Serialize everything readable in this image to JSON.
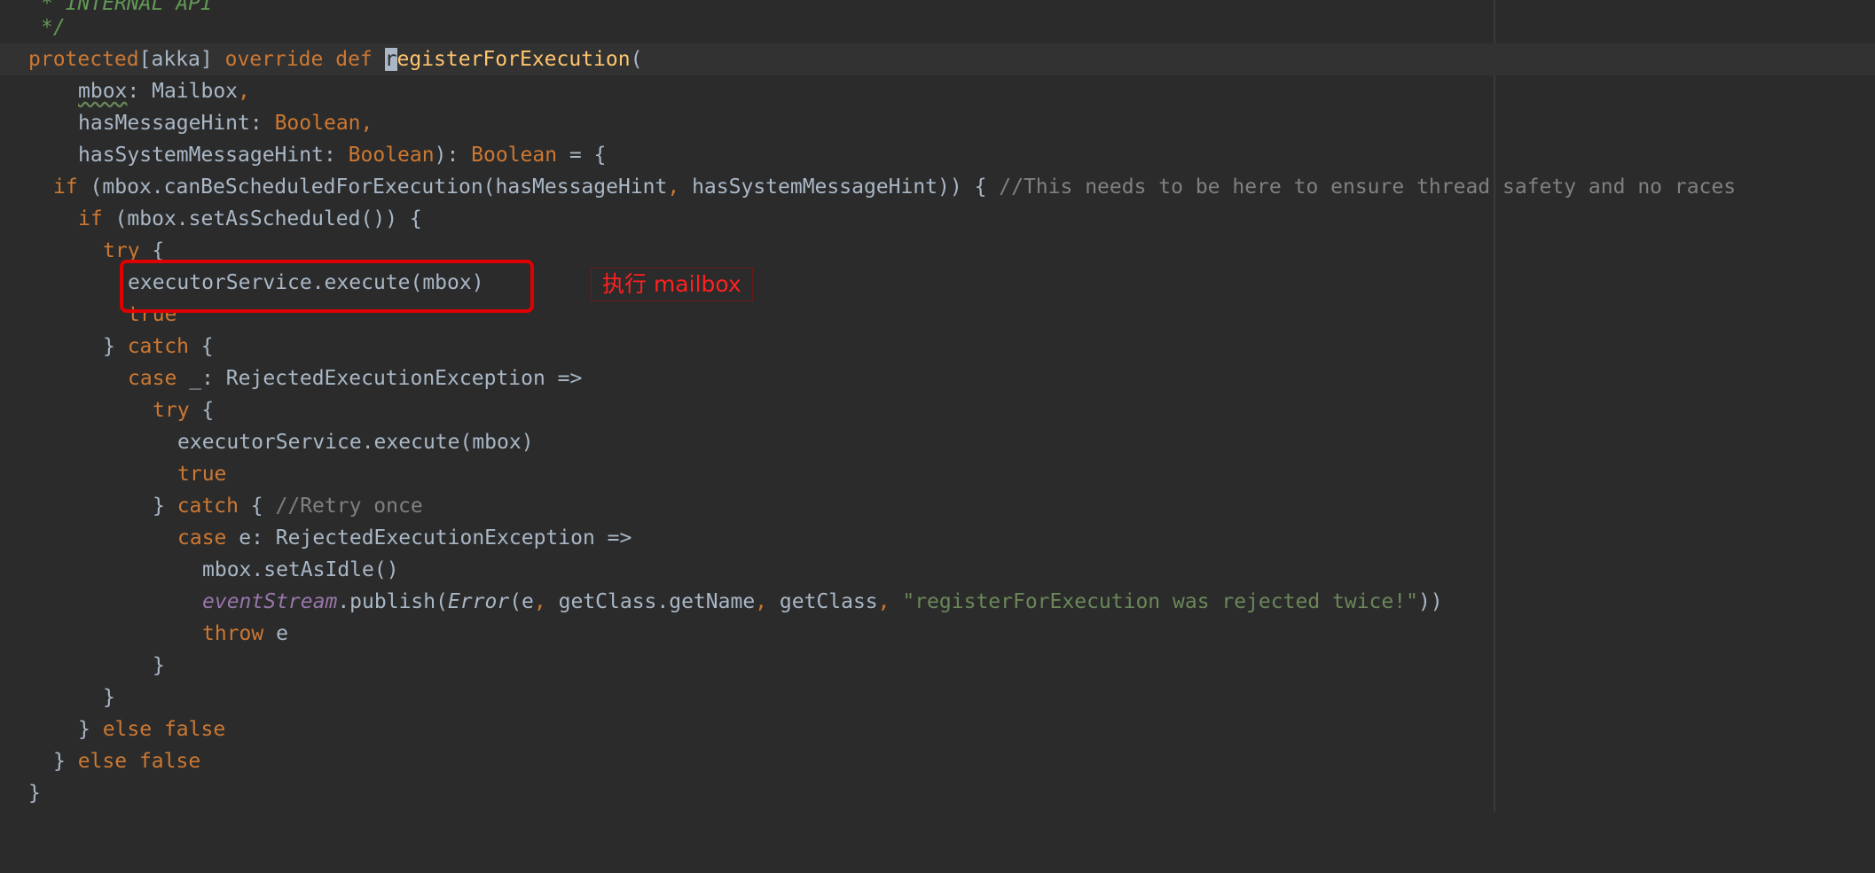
{
  "editor": {
    "top_line_fragment": "* INTERNAL API",
    "doc_end": "*/",
    "annotation_text": "执行 mailbox"
  },
  "code": {
    "l1": {
      "kw_protected": "protected",
      "bracket_open": "[",
      "akka": "akka",
      "bracket_close": "]",
      "kw_override": "override",
      "kw_def": "def",
      "caret_char": "r",
      "fn_rest": "egisterForExecution",
      "paren": "("
    },
    "l2": {
      "name": "mbox",
      "colon": ": ",
      "type": "Mailbox",
      "comma": ","
    },
    "l3": {
      "name": "hasMessageHint",
      "colon": ": ",
      "type": "Boolean",
      "comma": ","
    },
    "l4": {
      "name": "hasSystemMessageHint",
      "colon": ": ",
      "type": "Boolean",
      "close": "): ",
      "ret": "Boolean",
      "eq": " = {"
    },
    "l5": {
      "kw": "if",
      "a": " (mbox.canBeScheduledForExecution(hasMessageHint",
      "comma": ",",
      "b": " hasSystemMessageHint)) { ",
      "comment": "//This needs to be here to ensure thread safety and no races"
    },
    "l6": {
      "kw": "if",
      "rest": " (mbox.setAsScheduled()) {"
    },
    "l7": {
      "kw": "try",
      "rest": " {"
    },
    "l8": {
      "text": "executorService.execute(mbox)"
    },
    "l9": {
      "kw": "true"
    },
    "l10": {
      "brace": "} ",
      "kw": "catch",
      "rest": " {"
    },
    "l11": {
      "kw": "case",
      "rest": " _: RejectedExecutionException =>"
    },
    "l12": {
      "kw": "try",
      "rest": " {"
    },
    "l13": {
      "text": "executorService.execute(mbox)"
    },
    "l14": {
      "kw": "true"
    },
    "l15": {
      "brace": "} ",
      "kw": "catch",
      "rest": " { ",
      "comment": "//Retry once"
    },
    "l16": {
      "kw": "case",
      "rest": " e: RejectedExecutionException =>"
    },
    "l17": {
      "text": "mbox.setAsIdle()"
    },
    "l18": {
      "ev": "eventStream",
      "a": ".publish(",
      "err": "Error",
      "b": "(e",
      "c1": ",",
      "c": " getClass.getName",
      "c2": ",",
      "d": " getClass",
      "c3": ",",
      "str": " \"registerForExecution was rejected twice!\"",
      "e": "))"
    },
    "l19": {
      "kw": "throw",
      "rest": " e"
    },
    "l20": {
      "text": "}"
    },
    "l21": {
      "text": "}"
    },
    "l22": {
      "brace": "} ",
      "kw": "else false"
    },
    "l23": {
      "brace": "} ",
      "kw": "else false"
    },
    "l24": {
      "text": "}"
    }
  }
}
